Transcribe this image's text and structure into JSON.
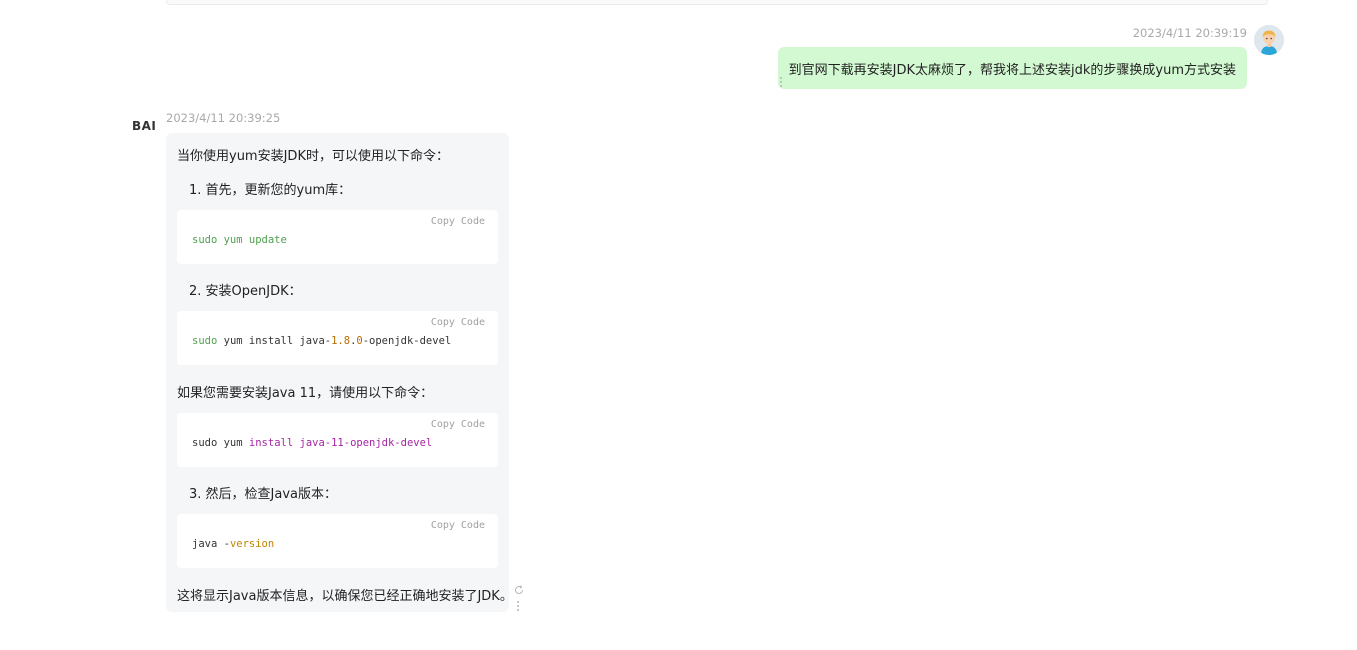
{
  "user_message": {
    "timestamp": "2023/4/11 20:39:19",
    "text": "到官网下载再安装JDK太麻烦了，帮我将上述安装jdk的步骤换成yum方式安装",
    "avatar_icon": "user-avatar-icon"
  },
  "bot_message": {
    "logo": "BAI",
    "timestamp": "2023/4/11 20:39:25",
    "intro": "当你使用yum安装JDK时，可以使用以下命令：",
    "step1": "1. 首先，更新您的yum库：",
    "step2": "2. 安装OpenJDK：",
    "java11_note": "如果您需要安装Java 11，请使用以下命令：",
    "step3": "3. 然后，检查Java版本：",
    "outro": "这将显示Java版本信息，以确保您已经正确地安装了JDK。",
    "copy_label": "Copy Code",
    "code1": {
      "t1": "sudo yum update"
    },
    "code2": {
      "t1": "sudo",
      "t2": " yum install java-",
      "t3": "1.8",
      "t4": ".",
      "t5": "0",
      "t6": "-openjdk-devel"
    },
    "code3": {
      "t1": "sudo yum ",
      "t2": "install",
      "t3": " ",
      "t4": "java-11-openjdk-devel"
    },
    "code4": {
      "t1": "java -",
      "t2": "version"
    }
  },
  "colors": {
    "user_bubble": "#d2f9d1",
    "bot_bubble": "#f4f6f8",
    "code_background": "#ffffff",
    "timestamp": "#a9a9a9"
  }
}
